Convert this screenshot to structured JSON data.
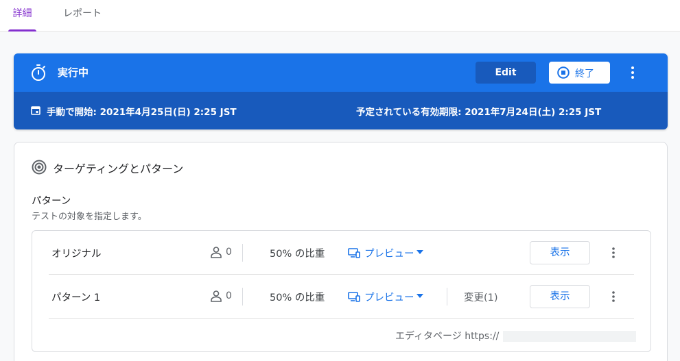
{
  "tabs": [
    {
      "label": "詳細",
      "active": true
    },
    {
      "label": "レポート",
      "active": false
    }
  ],
  "colors": {
    "accent_tab": "#8430ce",
    "banner_primary": "#1a73e8",
    "banner_secondary": "#185abc"
  },
  "status": {
    "icon": "timer-icon",
    "label": "実行中",
    "edit_label": "Edit",
    "end_label": "終了",
    "end_icon": "stop-circle-icon",
    "more_icon": "more-vert-icon",
    "started": "手動で開始: 2021年4月25日(日) 2:25 JST",
    "started_icon": "calendar-icon",
    "expires": "予定されている有効期限: 2021年7月24日(土) 2:25 JST"
  },
  "targeting": {
    "title": "ターゲティングとパターン",
    "icon": "target-icon",
    "patterns_title": "パターン",
    "patterns_desc": "テストの対象を指定します。",
    "variants": [
      {
        "name": "オリジナル",
        "sessions": "0",
        "weight": "50% の比重",
        "preview_label": "プレビュー",
        "changes": "",
        "view_label": "表示"
      },
      {
        "name": "パターン 1",
        "sessions": "0",
        "weight": "50% の比重",
        "preview_label": "プレビュー",
        "changes": "変更(1)",
        "view_label": "表示"
      }
    ],
    "editor_page_label": "エディタページ https://"
  }
}
